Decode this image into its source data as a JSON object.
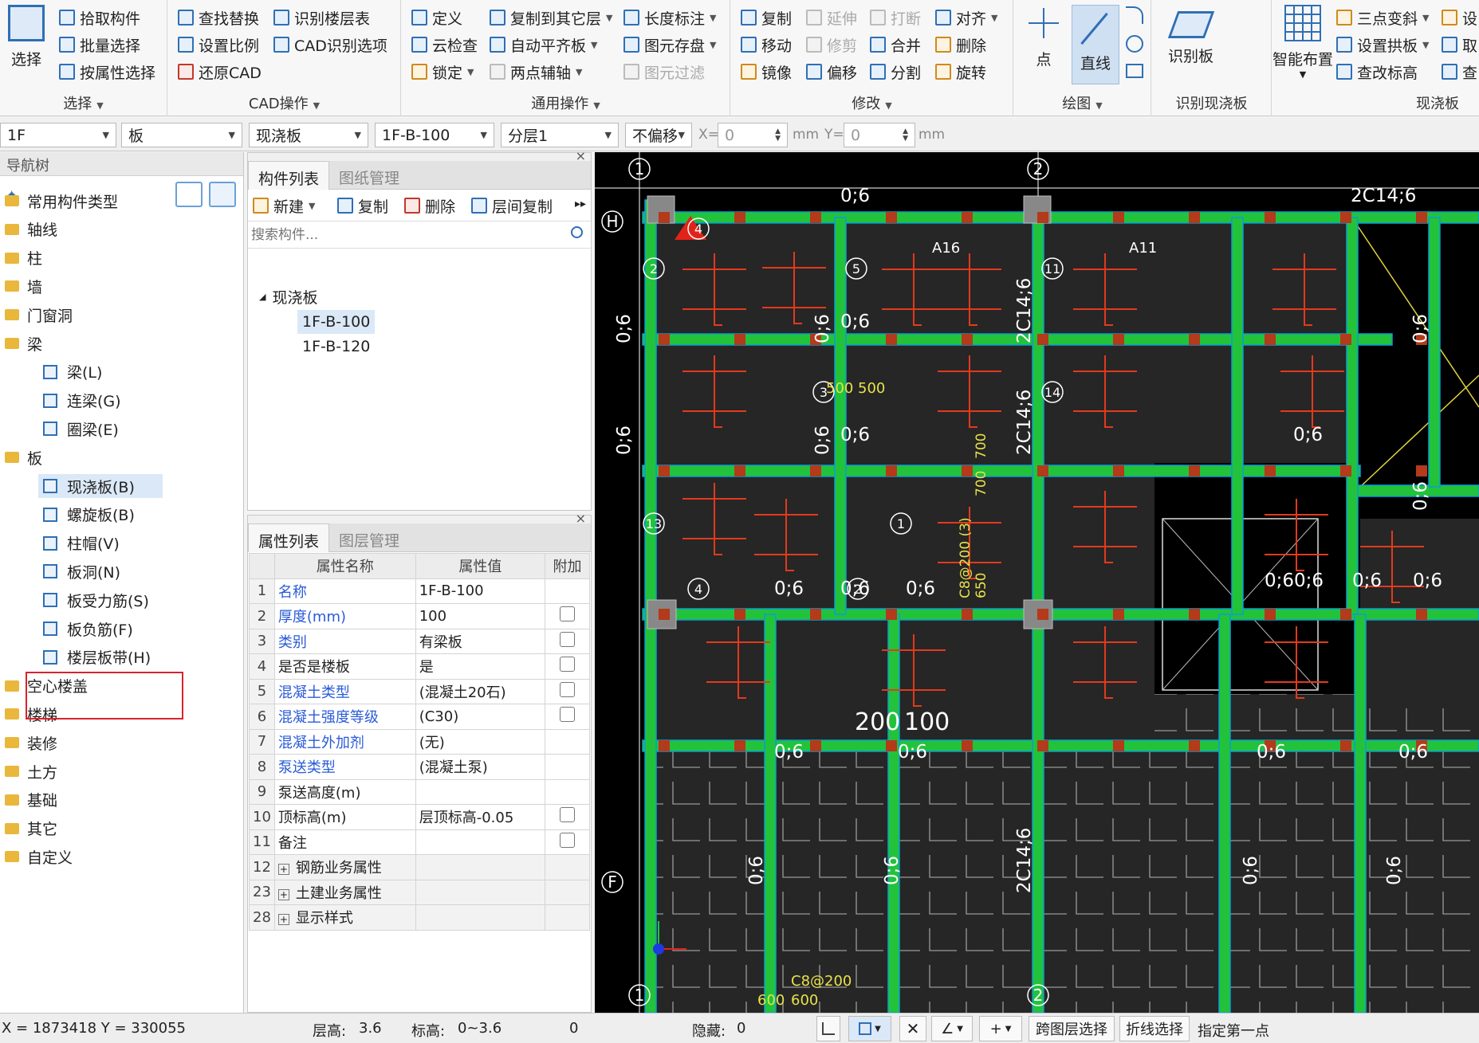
{
  "ribbon": {
    "select": {
      "big": "选择",
      "pick": "拾取构件",
      "batch": "批量选择",
      "by_prop": "按属性选择",
      "group": "选择"
    },
    "cad": {
      "find_replace": "查找替换",
      "identify_floor_table": "识别楼层表",
      "set_scale": "设置比例",
      "cad_options": "CAD识别选项",
      "restore_cad": "还原CAD",
      "group": "CAD操作"
    },
    "common": {
      "define": "定义",
      "copy_to_layer": "复制到其它层",
      "length_mark": "长度标注",
      "cloud_check": "云检查",
      "auto_align_slab": "自动平齐板",
      "save_element": "图元存盘",
      "lock": "锁定",
      "two_point_axis": "两点辅轴",
      "element_filter": "图元过滤",
      "group": "通用操作"
    },
    "modify": {
      "copy": "复制",
      "extend": "延伸",
      "break": "打断",
      "align": "对齐",
      "move": "移动",
      "trim": "修剪",
      "merge": "合并",
      "delete": "删除",
      "mirror": "镜像",
      "offset": "偏移",
      "split": "分割",
      "rotate": "旋转",
      "group": "修改"
    },
    "draw": {
      "point": "点",
      "line": "直线",
      "group": "绘图"
    },
    "identify": {
      "identify_slab": "识别板",
      "group": "识别现浇板"
    },
    "slab": {
      "smart_layout": "智能布置",
      "three_point_slope": "三点变斜",
      "set_arch": "设置拱板",
      "view_elev": "查改标高",
      "set": "设",
      "take": "取",
      "check": "查",
      "group": "现浇板"
    }
  },
  "selbar": {
    "floor": "1F",
    "category": "板",
    "type": "现浇板",
    "component": "1F-B-100",
    "layer": "分层1",
    "offset": "不偏移",
    "x_label": "X=",
    "x_val": "0",
    "y_label": "Y=",
    "y_val": "0",
    "unit": "mm"
  },
  "nav": {
    "title": "导航树",
    "items": [
      {
        "label": "常用构件类型",
        "kind": "folder"
      },
      {
        "label": "轴线",
        "kind": "folder"
      },
      {
        "label": "柱",
        "kind": "folder"
      },
      {
        "label": "墙",
        "kind": "folder"
      },
      {
        "label": "门窗洞",
        "kind": "folder"
      },
      {
        "label": "梁",
        "kind": "folder"
      },
      {
        "label": "梁(L)",
        "kind": "sub"
      },
      {
        "label": "连梁(G)",
        "kind": "sub"
      },
      {
        "label": "圈梁(E)",
        "kind": "sub"
      },
      {
        "label": "板",
        "kind": "folder"
      },
      {
        "label": "现浇板(B)",
        "kind": "sub",
        "selected": true
      },
      {
        "label": "螺旋板(B)",
        "kind": "sub"
      },
      {
        "label": "柱帽(V)",
        "kind": "sub"
      },
      {
        "label": "板洞(N)",
        "kind": "sub"
      },
      {
        "label": "板受力筋(S)",
        "kind": "sub"
      },
      {
        "label": "板负筋(F)",
        "kind": "sub"
      },
      {
        "label": "楼层板带(H)",
        "kind": "sub",
        "highlight": true
      },
      {
        "label": "空心楼盖",
        "kind": "folder"
      },
      {
        "label": "楼梯",
        "kind": "folder"
      },
      {
        "label": "装修",
        "kind": "folder"
      },
      {
        "label": "土方",
        "kind": "folder"
      },
      {
        "label": "基础",
        "kind": "folder"
      },
      {
        "label": "其它",
        "kind": "folder"
      },
      {
        "label": "自定义",
        "kind": "folder"
      }
    ]
  },
  "components": {
    "tab_active": "构件列表",
    "tab_other": "图纸管理",
    "new": "新建",
    "copy": "复制",
    "delete": "删除",
    "layer_copy": "层间复制",
    "search_placeholder": "搜索构件...",
    "root": "现浇板",
    "items": [
      "1F-B-100",
      "1F-B-120"
    ],
    "close": "×"
  },
  "properties": {
    "tab_active": "属性列表",
    "tab_other": "图层管理",
    "col_name": "属性名称",
    "col_value": "属性值",
    "col_extra": "附加",
    "close": "×",
    "rows": [
      {
        "n": "1",
        "name": "名称",
        "value": "1F-B-100",
        "blue": true,
        "check": false
      },
      {
        "n": "2",
        "name": "厚度(mm)",
        "value": "100",
        "blue": true,
        "check": true
      },
      {
        "n": "3",
        "name": "类别",
        "value": "有梁板",
        "blue": true,
        "check": true
      },
      {
        "n": "4",
        "name": "是否是楼板",
        "value": "是",
        "blue": false,
        "check": true
      },
      {
        "n": "5",
        "name": "混凝土类型",
        "value": "(混凝土20石)",
        "blue": true,
        "check": true
      },
      {
        "n": "6",
        "name": "混凝土强度等级",
        "value": "(C30)",
        "blue": true,
        "check": true
      },
      {
        "n": "7",
        "name": "混凝土外加剂",
        "value": "(无)",
        "blue": true,
        "check": false
      },
      {
        "n": "8",
        "name": "泵送类型",
        "value": "(混凝土泵)",
        "blue": true,
        "check": false
      },
      {
        "n": "9",
        "name": "泵送高度(m)",
        "value": "",
        "blue": false,
        "check": false
      },
      {
        "n": "10",
        "name": "顶标高(m)",
        "value": "层顶标高-0.05",
        "blue": false,
        "check": true
      },
      {
        "n": "11",
        "name": "备注",
        "value": "",
        "blue": false,
        "check": true
      },
      {
        "n": "12",
        "name": "钢筋业务属性",
        "value": "",
        "blue": false,
        "check": false,
        "group": true
      },
      {
        "n": "23",
        "name": "土建业务属性",
        "value": "",
        "blue": false,
        "check": false,
        "group": true
      },
      {
        "n": "28",
        "name": "显示样式",
        "value": "",
        "blue": false,
        "check": false,
        "group": true
      }
    ]
  },
  "cad": {
    "axes_top": [
      "1",
      "2"
    ],
    "axes_left": [
      "H",
      "F"
    ],
    "axes_bottom": [
      "1",
      "2"
    ],
    "labels": {
      "l1": "0;6",
      "l2": "2C14;6",
      "l3": "2C14;6",
      "l4": "700",
      "l5": "500",
      "l6": "500",
      "l7": "200",
      "l8": "100",
      "l9": "600",
      "l10": "600",
      "l11": "C8@200",
      "l12": "650",
      "l13": "A16",
      "l14": "A11",
      "l15": "0;60;6",
      "l16": "C8@200 (3)"
    },
    "marks": [
      "4",
      "2",
      "5",
      "11",
      "3",
      "14",
      "1",
      "13",
      "4",
      "2"
    ]
  },
  "status": {
    "coords": "X = 1873418 Y = 330055",
    "floor_h_label": "层高:",
    "floor_h": "3.6",
    "elev_label": "标高:",
    "elev": "0~3.6",
    "zero": "0",
    "hidden_label": "隐藏:",
    "hidden": "0",
    "cross_layer": "跨图层选择",
    "polyline": "折线选择",
    "prompt": "指定第一点"
  },
  "colors": {
    "beam": "#22c33a",
    "beam_edge": "#0a9dd6",
    "slab": "#2a2a2a",
    "rebar": "#e23a1d",
    "text": "#ffffff",
    "highlight_box": "#d9232d",
    "accent": "#2f6fb5"
  }
}
